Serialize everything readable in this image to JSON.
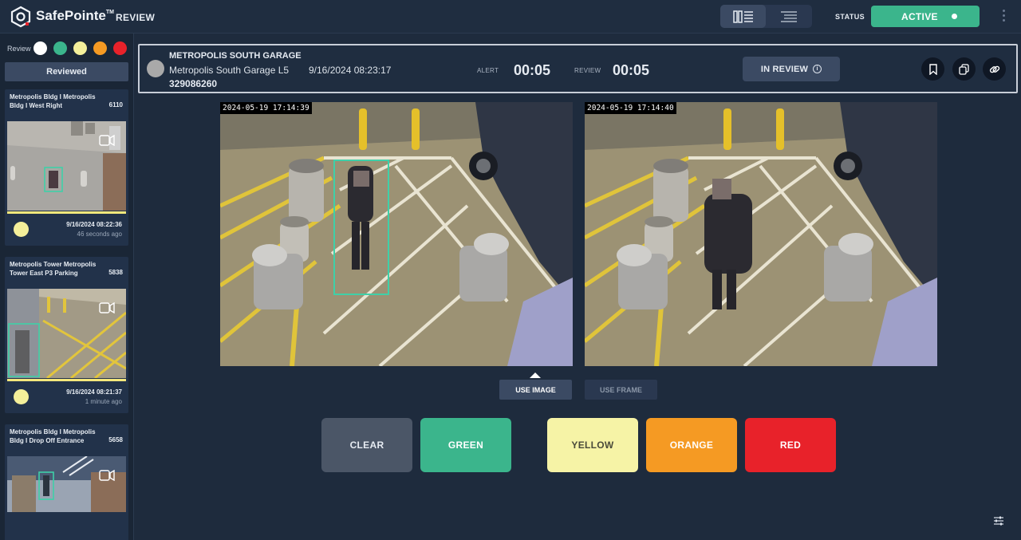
{
  "header": {
    "brand": "SafePointe",
    "brand_mark": "TM",
    "section": "REVIEW",
    "status_label": "STATUS",
    "status_value": "ACTIVE",
    "colors": {
      "active": "#3bb58c"
    }
  },
  "sidebar": {
    "filter_label": "Review",
    "filter_colors": [
      "#ffffff",
      "#3bb58c",
      "#f4ef9a",
      "#f59a23",
      "#e8222a"
    ],
    "tab_label": "Reviewed",
    "cards": [
      {
        "title": "Metropolis Bldg I Metropolis Bldg I West Right",
        "code": "6110",
        "date": "9/16/2024 08:22:36",
        "ago": "46 seconds ago",
        "rating_color": "#f4ef9a"
      },
      {
        "title": "Metropolis Tower Metropolis Tower East P3 Parking",
        "code": "5838",
        "date": "9/16/2024 08:21:37",
        "ago": "1 minute ago",
        "rating_color": "#f4ef9a"
      },
      {
        "title": "Metropolis Bldg I Metropolis Bldg I Drop Off Entrance",
        "code": "5658",
        "date": "",
        "ago": ""
      }
    ]
  },
  "alert": {
    "site": "METROPOLIS SOUTH GARAGE",
    "camera": "Metropolis South Garage L5",
    "timestamp": "9/16/2024 08:23:17",
    "id": "329086260",
    "alert_label": "ALERT",
    "alert_timer": "00:05",
    "review_label": "REVIEW",
    "review_timer": "00:05",
    "in_review_label": "IN REVIEW"
  },
  "images": {
    "left_ts": "2024-05-19  17:14:39",
    "right_ts": "2024-05-19  17:14:40",
    "use_image": "USE IMAGE",
    "use_frame": "USE FRAME"
  },
  "verdicts": [
    {
      "label": "CLEAR",
      "bg": "#4b5667",
      "fg": "#e6ebf2"
    },
    {
      "label": "GREEN",
      "bg": "#3bb58c",
      "fg": "#ffffff"
    },
    {
      "label": "YELLOW",
      "bg": "#f6f3a6",
      "fg": "#4a4a3a"
    },
    {
      "label": "ORANGE",
      "bg": "#f59a23",
      "fg": "#ffffff"
    },
    {
      "label": "RED",
      "bg": "#e8222a",
      "fg": "#ffffff"
    }
  ]
}
